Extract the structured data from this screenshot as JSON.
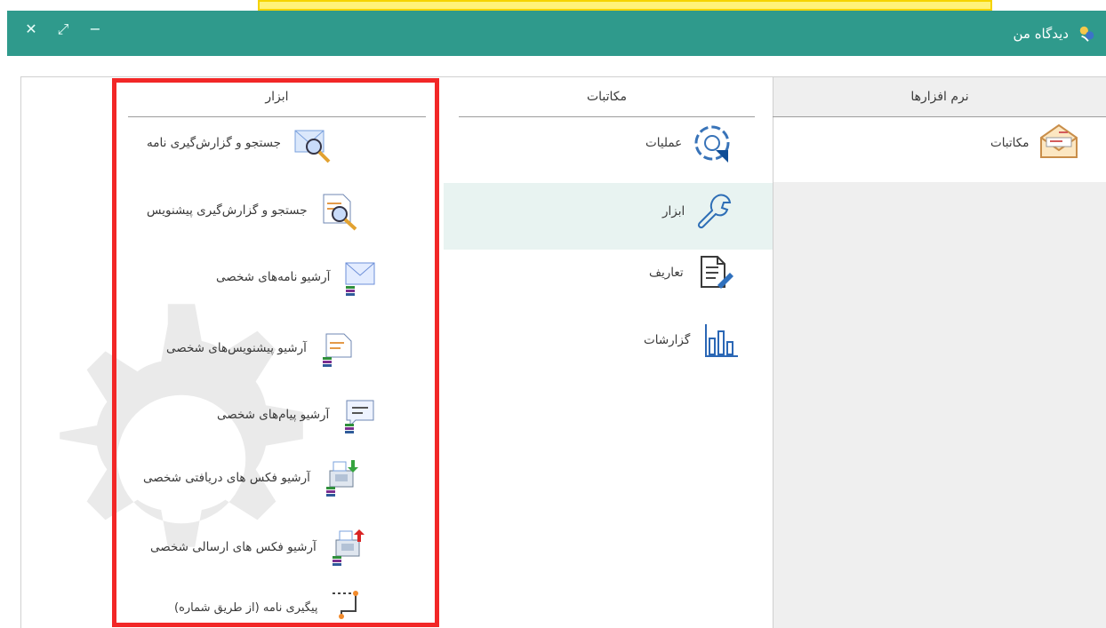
{
  "window": {
    "title": "دیدگاه من",
    "controls": [
      "close",
      "expand",
      "minimize"
    ]
  },
  "columns": {
    "software": {
      "header": "نرم افزارها",
      "items": [
        {
          "label": "مکاتبات",
          "icon": "envelope-icon"
        }
      ]
    },
    "correspondence": {
      "header": "مکاتبات",
      "items": [
        {
          "label": "عملیات",
          "icon": "operations-icon"
        },
        {
          "label": "ابزار",
          "icon": "wrench-icon",
          "selected": true
        },
        {
          "label": "تعاریف",
          "icon": "document-pen-icon"
        },
        {
          "label": "گزارشات",
          "icon": "bar-chart-icon"
        }
      ]
    },
    "tools": {
      "header": "ابزار",
      "items": [
        {
          "label": "جستجو و گزارش‌گیری نامه",
          "icon": "mail-search-icon"
        },
        {
          "label": "جستجو و گزارش‌گیری پیشنویس",
          "icon": "draft-search-icon"
        },
        {
          "label": "آرشیو نامه‌های شخصی",
          "icon": "mail-archive-icon"
        },
        {
          "label": "آرشیو پیشنویس‌های شخصی",
          "icon": "draft-archive-icon"
        },
        {
          "label": "آرشیو پیام‌های شخصی",
          "icon": "message-archive-icon"
        },
        {
          "label": "آرشیو فکس های دریافتی شخصی",
          "icon": "fax-received-icon"
        },
        {
          "label": "آرشیو فکس های ارسالی شخصی",
          "icon": "fax-sent-icon"
        },
        {
          "label": "پیگیری نامه (از طریق شماره)",
          "icon": "track-letter-icon"
        }
      ]
    }
  },
  "colors": {
    "titlebar": "#2f9a8c",
    "selection": "#e8f3f1",
    "highlight_box": "#f22727",
    "top_highlight": "#fff27a"
  }
}
